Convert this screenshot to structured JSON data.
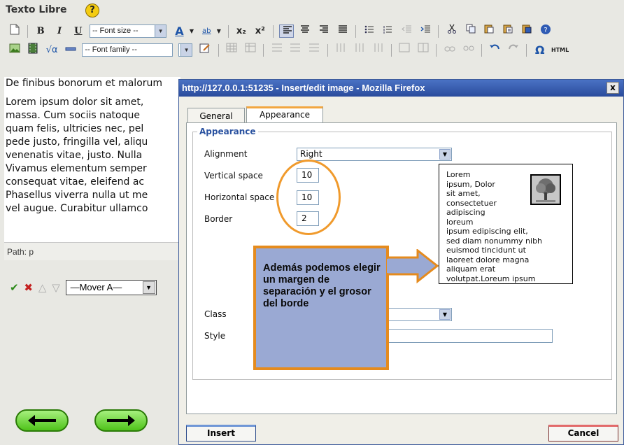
{
  "header": {
    "title": "Texto Libre",
    "help_glyph": "?"
  },
  "toolbar1": {
    "font_size": "-- Font size --",
    "buttons": [
      "new-document-icon",
      "bold-icon",
      "italic-icon",
      "underline-icon",
      "font-color-icon",
      "highlight-color-icon",
      "subscript-icon",
      "superscript-icon",
      "align-left-icon",
      "align-center-icon",
      "align-right-icon",
      "justify-icon",
      "bullet-list-icon",
      "numbered-list-icon",
      "outdent-icon",
      "indent-icon",
      "cut-icon",
      "copy-icon",
      "paste-icon",
      "paste-text-icon",
      "paste-word-icon",
      "help-icon"
    ],
    "bold": "B",
    "italic": "I",
    "underline": "U",
    "font_color": "A",
    "highlight": "ab",
    "sub": "x₂",
    "sup": "x²"
  },
  "toolbar2": {
    "font_family": "-- Font family --",
    "omega": "Ω",
    "html": "HTML"
  },
  "editor": {
    "line1": "De finibus bonorum et malorum",
    "para": [
      "Lorem ipsum dolor sit amet,",
      "massa. Cum sociis natoque",
      "quam felis, ultricies nec, pel",
      "pede justo, fringilla vel, aliqu",
      "venenatis vitae, justo. Nulla",
      "Vivamus elementum semper",
      "consequat vitae, eleifend ac",
      "Phasellus viverra nulla ut me",
      "vel augue. Curabitur ullamco"
    ],
    "path": "Path: p"
  },
  "left_controls": {
    "mover": "—Mover A—"
  },
  "dialog": {
    "title": "http://127.0.0.1:51235 - Insert/edit image - Mozilla Firefox",
    "close": "x",
    "tabs": [
      "General",
      "Appearance"
    ],
    "legend": "Appearance",
    "alignment_label": "Alignment",
    "alignment_value": "Right",
    "vspace_label": "Vertical space",
    "vspace_value": "10",
    "hspace_label": "Horizontal space",
    "hspace_value": "10",
    "border_label": "Border",
    "border_value": "2",
    "class_label": "Class",
    "style_label": "Style",
    "preview_lines": [
      "Lorem",
      "ipsum, Dolor",
      "sit amet,",
      "consectetuer",
      "adipiscing",
      "loreum",
      "ipsum edipiscing elit,",
      "sed diam nonummy nibh",
      "euismod tincidunt ut",
      "laoreet dolore magna",
      "aliquam erat",
      "volutpat.Loreum ipsum"
    ],
    "insert": "Insert",
    "cancel": "Cancel"
  },
  "callout": {
    "text": "Además podemos elegir un margen de separación y el grosor del borde",
    "fill": "#9aa9d3",
    "border": "#e58b1e"
  }
}
